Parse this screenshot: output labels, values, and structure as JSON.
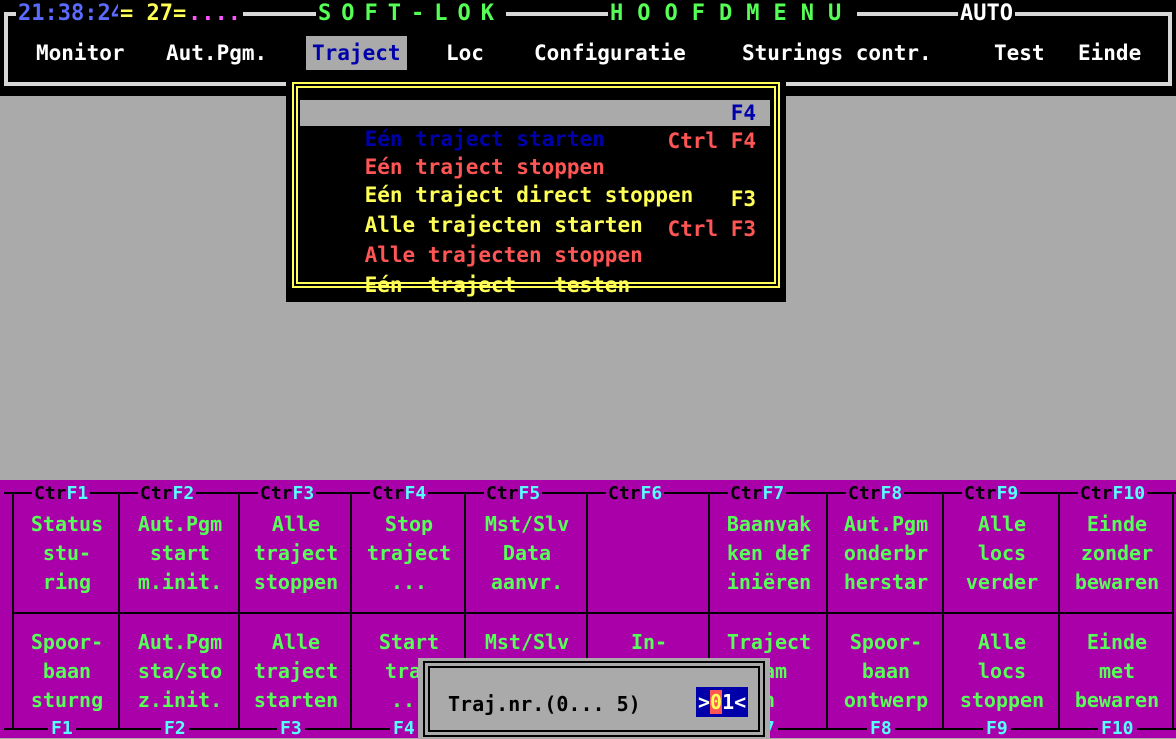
{
  "header": {
    "clock": "21:38:24",
    "count": "= 27=",
    "dots": "....",
    "title": "SOFT-LOK",
    "menu_title": "HOOFDMENU",
    "mode": "AUTO",
    "colors": {
      "background": "#000000",
      "clock": "#5b6bff",
      "title": "#55ff55"
    }
  },
  "menubar": {
    "items": [
      {
        "label": "Monitor"
      },
      {
        "label": "Aut.Pgm."
      },
      {
        "label": "Traject"
      },
      {
        "label": "Loc"
      },
      {
        "label": "Configuratie"
      },
      {
        "label": "Sturings contr."
      },
      {
        "label": "Test"
      },
      {
        "label": "Einde"
      }
    ],
    "active": "Traject"
  },
  "dropdown": {
    "items": [
      {
        "label": "Eén traject starten",
        "key": "F4"
      },
      {
        "label": "Eén traject stoppen",
        "key": "Ctrl F4"
      },
      {
        "label": "Eén traject direct stoppen",
        "key": ""
      },
      {
        "label": "Alle trajecten starten",
        "key": "F3"
      },
      {
        "label": "Alle trajecten stoppen",
        "key": "Ctrl F3"
      },
      {
        "label": "Eén  traject   testen",
        "key": ""
      }
    ],
    "selected": "Eén traject starten"
  },
  "function_keys": {
    "ctrl": [
      {
        "key": "F1",
        "lines": [
          "Status",
          "stu-",
          "ring"
        ]
      },
      {
        "key": "F2",
        "lines": [
          "Aut.Pgm",
          "start",
          "m.init."
        ]
      },
      {
        "key": "F3",
        "lines": [
          "Alle",
          "traject",
          "stoppen"
        ]
      },
      {
        "key": "F4",
        "lines": [
          "Stop",
          "traject",
          "..."
        ]
      },
      {
        "key": "F5",
        "lines": [
          "Mst/Slv",
          "Data",
          "aanvr."
        ]
      },
      {
        "key": "F6",
        "lines": [
          "",
          "",
          ""
        ]
      },
      {
        "key": "F7",
        "lines": [
          "Baanvak",
          "ken def",
          "iniëren"
        ]
      },
      {
        "key": "F8",
        "lines": [
          "Aut.Pgm",
          "onderbr",
          "herstar"
        ]
      },
      {
        "key": "F9",
        "lines": [
          "Alle",
          "locs",
          "verder"
        ]
      },
      {
        "key": "F10",
        "lines": [
          "Einde",
          "zonder",
          "bewaren"
        ]
      }
    ],
    "plain": [
      {
        "key": "F1",
        "lines": [
          "Spoor-",
          "baan",
          "sturng"
        ]
      },
      {
        "key": "F2",
        "lines": [
          "Aut.Pgm",
          "sta/sto",
          "z.init."
        ]
      },
      {
        "key": "F3",
        "lines": [
          "Alle",
          "traject",
          "starten"
        ]
      },
      {
        "key": "F4",
        "lines": [
          "Start",
          "traj",
          "..."
        ]
      },
      {
        "key": "F5",
        "lines": [
          "Mst/Slv",
          "",
          ""
        ]
      },
      {
        "key": "F6",
        "lines": [
          "In-",
          "",
          ""
        ]
      },
      {
        "key": "F7",
        "lines": [
          "Traject",
          "ram",
          "n"
        ]
      },
      {
        "key": "F8",
        "lines": [
          "Spoor-",
          "baan",
          "ontwerp"
        ]
      },
      {
        "key": "F9",
        "lines": [
          "Alle",
          "locs",
          "stoppen"
        ]
      },
      {
        "key": "F10",
        "lines": [
          "Einde",
          "met",
          "bewaren"
        ]
      }
    ],
    "ctrl_prefix": "Ctr",
    "colors": {
      "panel": "#aa00aa",
      "text": "#55ff55",
      "key": "#55ffff"
    }
  },
  "dialog": {
    "label": "Traj.nr.(0... 5)",
    "value_prefix": ">",
    "value_cursor": "0",
    "value_rest": "1",
    "value_suffix": "<"
  }
}
